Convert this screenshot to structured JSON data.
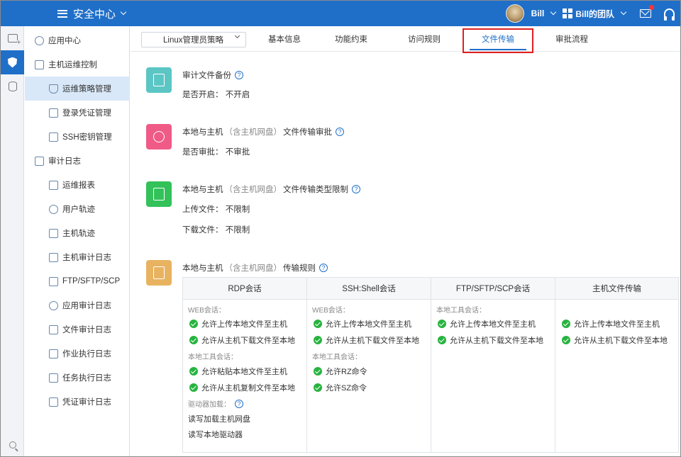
{
  "header": {
    "app_title": "安全中心",
    "user_name": "Bill",
    "team_name": "Bill的团队"
  },
  "sidebar": {
    "items": [
      {
        "label": "应用中心",
        "level": 1
      },
      {
        "label": "主机运维控制",
        "level": 1
      },
      {
        "label": "运维策略管理",
        "level": 2,
        "active": true
      },
      {
        "label": "登录凭证管理",
        "level": 2
      },
      {
        "label": "SSH密钥管理",
        "level": 2
      },
      {
        "label": "审计日志",
        "level": 1
      },
      {
        "label": "运维报表",
        "level": 2
      },
      {
        "label": "用户轨迹",
        "level": 2
      },
      {
        "label": "主机轨迹",
        "level": 2
      },
      {
        "label": "主机审计日志",
        "level": 2
      },
      {
        "label": "FTP/SFTP/SCP",
        "level": 2
      },
      {
        "label": "应用审计日志",
        "level": 2
      },
      {
        "label": "文件审计日志",
        "level": 2
      },
      {
        "label": "作业执行日志",
        "level": 2
      },
      {
        "label": "任务执行日志",
        "level": 2
      },
      {
        "label": "凭证审计日志",
        "level": 2
      }
    ]
  },
  "policy_select": {
    "value": "Linux管理员策略"
  },
  "tabs": [
    {
      "label": "基本信息"
    },
    {
      "label": "功能约束"
    },
    {
      "label": "访问规则"
    },
    {
      "label": "文件传输",
      "active": true
    },
    {
      "label": "审批流程"
    }
  ],
  "colors": {
    "brand": "#1f6fc9",
    "highlight_box": "#e02020",
    "check": "#27b33f",
    "icon_backup": "#5bc6c4",
    "icon_approval": "#ef5b86",
    "icon_type": "#33c15a",
    "icon_rules": "#e8b360"
  },
  "sections": {
    "backup": {
      "icon": "audit-backup-icon",
      "title": "审计文件备份",
      "line1_label": "是否开启：",
      "line1_value": "不开启"
    },
    "approval": {
      "icon": "approval-icon",
      "title_a": "本地与主机",
      "title_muted": "（含主机网盘）",
      "title_b": "文件传输审批",
      "line1_label": "是否审批：",
      "line1_value": "不审批"
    },
    "type_limit": {
      "icon": "file-type-limit-icon",
      "title_a": "本地与主机",
      "title_muted": "（含主机网盘）",
      "title_b": "文件传输类型限制",
      "upload_label": "上传文件：",
      "upload_value": "不限制",
      "download_label": "下载文件：",
      "download_value": "不限制"
    },
    "rules": {
      "icon": "transfer-rules-icon",
      "title_a": "本地与主机",
      "title_muted": "（含主机网盘）",
      "title_b": "传输规则"
    }
  },
  "rules_table": {
    "columns": [
      {
        "header": "RDP会话",
        "web_label": "WEB会话：",
        "web_rules": [
          "允许上传本地文件至主机",
          "允许从主机下载文件至本地"
        ],
        "local_label": "本地工具会话：",
        "local_rules": [
          "允许粘贴本地文件至主机",
          "允许从主机复制文件至本地"
        ],
        "drive_label": "驱动器加载：",
        "drive_items": [
          "读写加载主机网盘",
          "读写本地驱动器"
        ]
      },
      {
        "header": "SSH:Shell会话",
        "web_label": "WEB会话：",
        "web_rules": [
          "允许上传本地文件至主机",
          "允许从主机下载文件至本地"
        ],
        "local_label": "本地工具会话：",
        "local_rules": [
          "允许RZ命令",
          "允许SZ命令"
        ]
      },
      {
        "header": "FTP/SFTP/SCP会话",
        "local_label": "本地工具会话：",
        "local_rules": [
          "允许上传本地文件至主机",
          "允许从主机下载文件至本地"
        ]
      },
      {
        "header": "主机文件传输",
        "rules": [
          "允许上传本地文件至主机",
          "允许从主机下载文件至本地"
        ]
      }
    ]
  }
}
